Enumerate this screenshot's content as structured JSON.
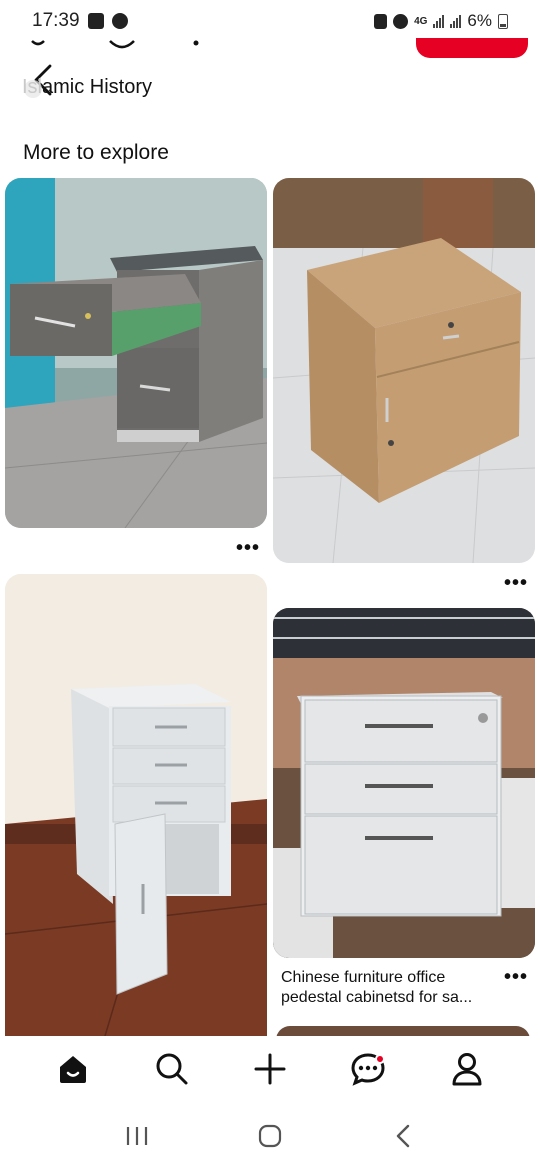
{
  "status_bar": {
    "time": "17:39",
    "network": "4G",
    "battery": "6%",
    "icons": [
      "gallery-icon",
      "chat-bubble-icon",
      "battery-saver-icon",
      "alarm-icon",
      "signal-icon",
      "signal-icon",
      "battery-icon"
    ]
  },
  "header": {
    "board_title_faded": "Isl",
    "board_title": "amic History",
    "back_icon": "back-arrow-icon"
  },
  "section": {
    "title": "More to explore"
  },
  "pins": [
    {
      "image": "gray-wood-pedestal-drawer-open",
      "has_more_menu": true,
      "more_label": "•••"
    },
    {
      "image": "light-oak-pedestal-cabinet",
      "has_more_menu": true,
      "more_label": "•••"
    },
    {
      "image": "white-pedestal-door-open",
      "has_more_menu": false
    },
    {
      "image": "white-three-drawer-pedestal-warehouse",
      "has_more_menu": true,
      "more_label": "•••",
      "caption_line1": "Chinese furniture office",
      "caption_line2": "pedestal cabinetsd for sa..."
    }
  ],
  "bottom_nav": {
    "items": [
      "home-icon",
      "search-icon",
      "create-plus-icon",
      "messages-icon",
      "profile-icon"
    ],
    "active": "home-icon",
    "notification_on": "messages-icon"
  },
  "system_nav": {
    "items": [
      "recent-apps-icon",
      "home-button-icon",
      "back-icon"
    ]
  },
  "colors": {
    "brand_red": "#e60023",
    "text": "#111111"
  }
}
